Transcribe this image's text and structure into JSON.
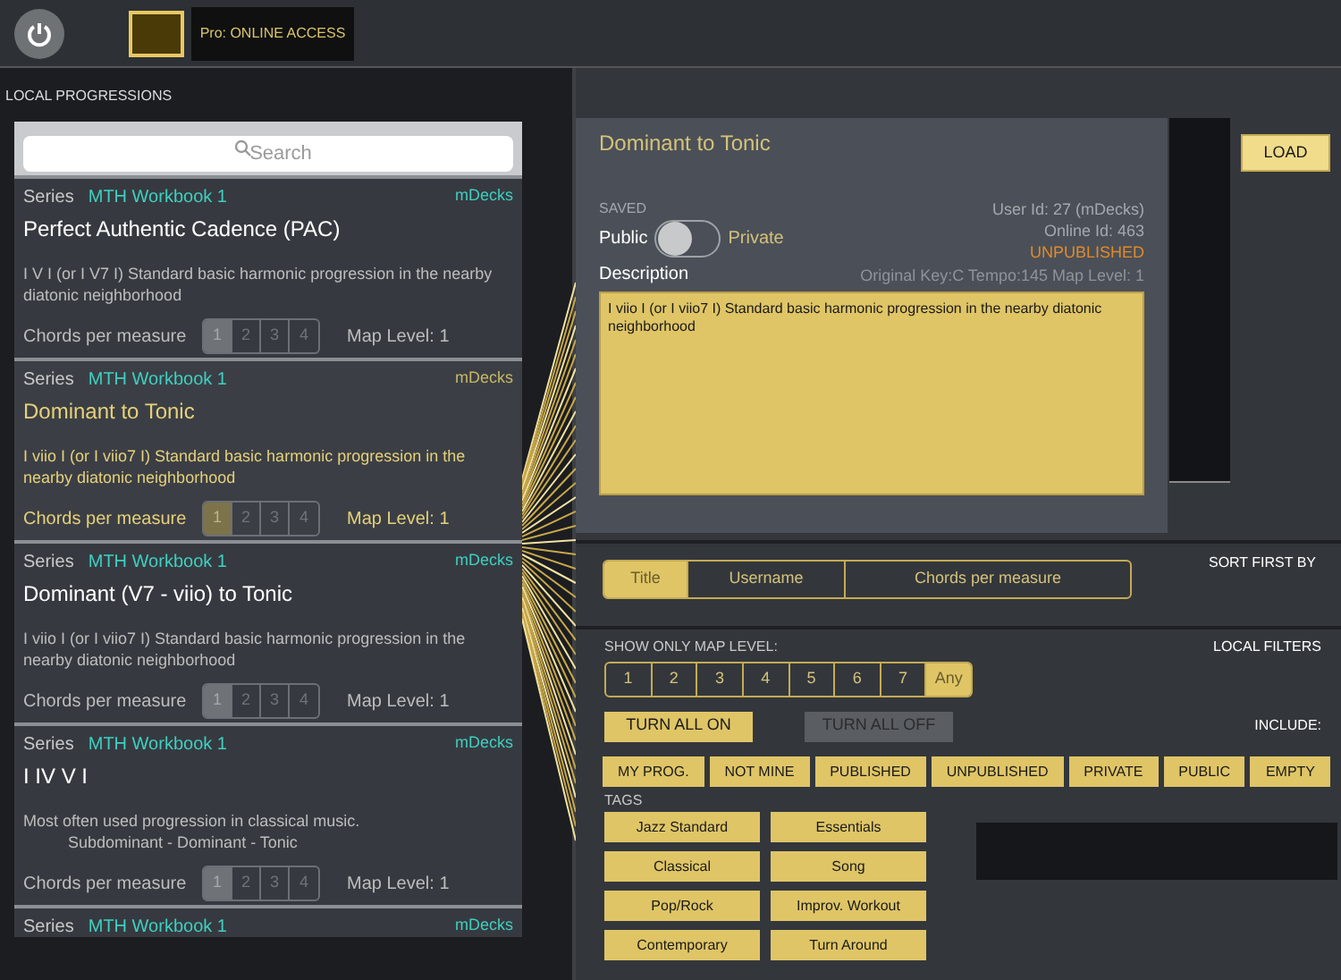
{
  "top_bar": {
    "pro_label": "Pro: ONLINE ACCESS"
  },
  "local_progressions": {
    "heading": "LOCAL PROGRESSIONS",
    "search": {
      "placeholder": "Search"
    },
    "items": [
      {
        "series_label": "Series",
        "series": "MTH Workbook 1",
        "author": "mDecks",
        "title": "Perfect Authentic Cadence (PAC)",
        "description": "I V I (or I V7 I) Standard basic harmonic progression in the nearby diatonic neighborhood",
        "chords_label": "Chords per measure",
        "chord_options": [
          {
            "label": "1",
            "selected": true
          },
          {
            "label": "2",
            "selected": false
          },
          {
            "label": "3",
            "selected": false
          },
          {
            "label": "4",
            "selected": false
          }
        ],
        "map_level": "Map Level: 1",
        "selected": false
      },
      {
        "series_label": "Series",
        "series": "MTH Workbook 1",
        "author": "mDecks",
        "title": "Dominant to Tonic",
        "description": "I viio I (or I viio7 I) Standard basic harmonic progression in the nearby diatonic neighborhood",
        "chords_label": "Chords per measure",
        "chord_options": [
          {
            "label": "1",
            "selected": true
          },
          {
            "label": "2",
            "selected": false
          },
          {
            "label": "3",
            "selected": false
          },
          {
            "label": "4",
            "selected": false
          }
        ],
        "map_level": "Map Level: 1",
        "selected": true
      },
      {
        "series_label": "Series",
        "series": "MTH Workbook 1",
        "author": "mDecks",
        "title": "Dominant (V7 - viio) to Tonic",
        "description": "I viio I (or I viio7 I) Standard basic harmonic progression in the nearby diatonic neighborhood",
        "chords_label": "Chords per measure",
        "chord_options": [
          {
            "label": "1",
            "selected": true
          },
          {
            "label": "2",
            "selected": false
          },
          {
            "label": "3",
            "selected": false
          },
          {
            "label": "4",
            "selected": false
          }
        ],
        "map_level": "Map Level: 1",
        "selected": false
      },
      {
        "series_label": "Series",
        "series": "MTH Workbook 1",
        "author": "mDecks",
        "title": "I IV V I",
        "description": "Most often used progression in classical music.\n          Subdominant - Dominant - Tonic",
        "chords_label": "Chords per measure",
        "chord_options": [
          {
            "label": "1",
            "selected": true
          },
          {
            "label": "2",
            "selected": false
          },
          {
            "label": "3",
            "selected": false
          },
          {
            "label": "4",
            "selected": false
          }
        ],
        "map_level": "Map Level: 1",
        "selected": false
      },
      {
        "series_label": "Series",
        "series": "MTH Workbook 1",
        "author": "mDecks",
        "selected": false
      }
    ]
  },
  "detail": {
    "title": "Dominant to Tonic",
    "saved": "SAVED",
    "public_label": "Public",
    "private_label": "Private",
    "private_on": false,
    "user_id": "User Id: 27 (mDecks)",
    "online_id": "Online Id: 463",
    "status": "UNPUBLISHED",
    "description_label": "Description",
    "meta": "Original Key:C Tempo:145 Map Level: 1",
    "description": "I viio I (or I viio7 I) Standard basic harmonic progression in the nearby diatonic neighborhood",
    "load_button": "LOAD"
  },
  "sort": {
    "heading": "SORT FIRST BY",
    "options": [
      {
        "label": "Title",
        "selected": true
      },
      {
        "label": "Username",
        "selected": false
      },
      {
        "label": "Chords per measure",
        "selected": false
      }
    ]
  },
  "filters": {
    "heading": "LOCAL FILTERS",
    "map_level_label": "SHOW ONLY MAP LEVEL:",
    "map_levels": [
      {
        "label": "1",
        "selected": false
      },
      {
        "label": "2",
        "selected": false
      },
      {
        "label": "3",
        "selected": false
      },
      {
        "label": "4",
        "selected": false
      },
      {
        "label": "5",
        "selected": false
      },
      {
        "label": "6",
        "selected": false
      },
      {
        "label": "7",
        "selected": false
      },
      {
        "label": "Any",
        "selected": true
      }
    ],
    "turn_all_on": {
      "label": "TURN ALL ON",
      "disabled": false
    },
    "turn_all_off": {
      "label": "TURN ALL OFF",
      "disabled": true
    },
    "include_label": "INCLUDE:",
    "include": [
      {
        "label": "MY PROG.",
        "on": true
      },
      {
        "label": "NOT MINE",
        "on": true
      },
      {
        "label": "PUBLISHED",
        "on": true
      },
      {
        "label": "UNPUBLISHED",
        "on": true
      },
      {
        "label": "PRIVATE",
        "on": true
      },
      {
        "label": "PUBLIC",
        "on": true
      },
      {
        "label": "EMPTY",
        "on": true
      }
    ],
    "tags_label": "TAGS",
    "tags": [
      {
        "label": "Jazz Standard",
        "on": true
      },
      {
        "label": "Essentials",
        "on": true
      },
      {
        "label": "Classical",
        "on": true
      },
      {
        "label": "Song",
        "on": true
      },
      {
        "label": "Pop/Rock",
        "on": true
      },
      {
        "label": "Improv. Workout",
        "on": true
      },
      {
        "label": "Contemporary",
        "on": true
      },
      {
        "label": "Turn Around",
        "on": true
      }
    ]
  }
}
